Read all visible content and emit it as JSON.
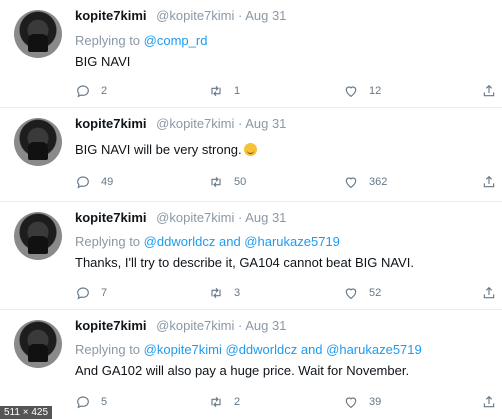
{
  "tweets": [
    {
      "name": "kopite7kimi",
      "handle": "@kopite7kimi · Aug 31",
      "reply_prefix": "Replying to",
      "reply_to": "@comp_rd",
      "text": "BIG NAVI",
      "counts": {
        "comments": "2",
        "retweets": "1",
        "likes": "12"
      }
    },
    {
      "name": "kopite7kimi",
      "handle": "@kopite7kimi · Aug 31",
      "text": "BIG NAVI will be very strong.",
      "counts": {
        "comments": "49",
        "retweets": "50",
        "likes": "362"
      }
    },
    {
      "name": "kopite7kimi",
      "handle": "@kopite7kimi · Aug 31",
      "reply_prefix": "Replying to",
      "reply_to": "@ddworldcz and @harukaze5719",
      "text": "Thanks, I'll try to describe it, GA104 cannot beat BIG NAVI.",
      "counts": {
        "comments": "7",
        "retweets": "3",
        "likes": "52"
      }
    },
    {
      "name": "kopite7kimi",
      "handle": "@kopite7kimi · Aug 31",
      "reply_prefix": "Replying to",
      "reply_to": "@kopite7kimi @ddworldcz and @harukaze5719",
      "text": "And GA102 will also pay a huge price. Wait for November.",
      "counts": {
        "comments": "5",
        "retweets": "2",
        "likes": "39"
      }
    }
  ],
  "image_size_label": "511 × 425",
  "icons": {
    "comment": "comment-icon",
    "retweet": "retweet-icon",
    "like": "heart-icon",
    "share": "share-icon"
  },
  "colors": {
    "link": "#1d9bf0",
    "muted": "#8b98a5",
    "text": "#0f1419"
  }
}
